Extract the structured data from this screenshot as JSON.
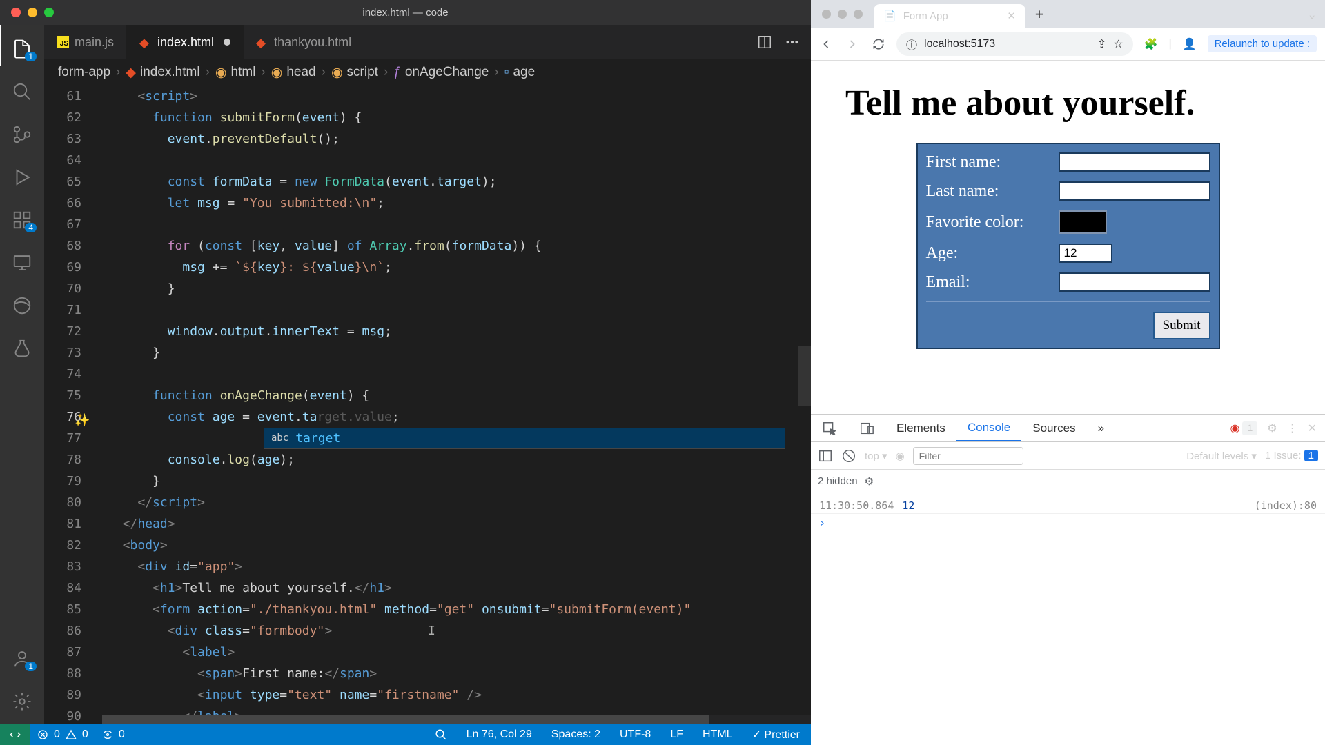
{
  "vscode": {
    "window_title": "index.html — code",
    "tabs": [
      {
        "label": "main.js",
        "icon": "js"
      },
      {
        "label": "index.html",
        "icon": "html",
        "active": true,
        "dirty": true
      },
      {
        "label": "thankyou.html",
        "icon": "html"
      }
    ],
    "breadcrumb": [
      "form-app",
      "index.html",
      "html",
      "head",
      "script",
      "onAgeChange",
      "age"
    ],
    "activity_badges": {
      "explorer": "1",
      "ext": "4",
      "account": "1"
    },
    "lines": [
      {
        "n": 61,
        "tokens": [
          [
            "k-white",
            "    "
          ],
          [
            "k-brack",
            "<"
          ],
          [
            "k-tag",
            "script"
          ],
          [
            "k-brack",
            ">"
          ]
        ]
      },
      {
        "n": 62,
        "tokens": [
          [
            "k-white",
            "      "
          ],
          [
            "k-blue",
            "function"
          ],
          [
            "k-white",
            " "
          ],
          [
            "k-yellow",
            "submitForm"
          ],
          [
            "k-white",
            "("
          ],
          [
            "k-var",
            "event"
          ],
          [
            "k-white",
            ") {"
          ]
        ]
      },
      {
        "n": 63,
        "tokens": [
          [
            "k-white",
            "        "
          ],
          [
            "k-var",
            "event"
          ],
          [
            "k-white",
            "."
          ],
          [
            "k-yellow",
            "preventDefault"
          ],
          [
            "k-white",
            "();"
          ]
        ]
      },
      {
        "n": 64,
        "tokens": []
      },
      {
        "n": 65,
        "tokens": [
          [
            "k-white",
            "        "
          ],
          [
            "k-blue",
            "const"
          ],
          [
            "k-white",
            " "
          ],
          [
            "k-var",
            "formData"
          ],
          [
            "k-white",
            " = "
          ],
          [
            "k-blue",
            "new"
          ],
          [
            "k-white",
            " "
          ],
          [
            "k-type",
            "FormData"
          ],
          [
            "k-white",
            "("
          ],
          [
            "k-var",
            "event"
          ],
          [
            "k-white",
            "."
          ],
          [
            "k-var",
            "target"
          ],
          [
            "k-white",
            ");"
          ]
        ]
      },
      {
        "n": 66,
        "tokens": [
          [
            "k-white",
            "        "
          ],
          [
            "k-blue",
            "let"
          ],
          [
            "k-white",
            " "
          ],
          [
            "k-var",
            "msg"
          ],
          [
            "k-white",
            " = "
          ],
          [
            "k-str",
            "\"You submitted:\\n\""
          ],
          [
            "k-white",
            ";"
          ]
        ]
      },
      {
        "n": 67,
        "tokens": []
      },
      {
        "n": 68,
        "tokens": [
          [
            "k-white",
            "        "
          ],
          [
            "k-purple",
            "for"
          ],
          [
            "k-white",
            " ("
          ],
          [
            "k-blue",
            "const"
          ],
          [
            "k-white",
            " ["
          ],
          [
            "k-var",
            "key"
          ],
          [
            "k-white",
            ", "
          ],
          [
            "k-var",
            "value"
          ],
          [
            "k-white",
            "] "
          ],
          [
            "k-blue",
            "of"
          ],
          [
            "k-white",
            " "
          ],
          [
            "k-type",
            "Array"
          ],
          [
            "k-white",
            "."
          ],
          [
            "k-yellow",
            "from"
          ],
          [
            "k-white",
            "("
          ],
          [
            "k-var",
            "formData"
          ],
          [
            "k-white",
            ")) {"
          ]
        ]
      },
      {
        "n": 69,
        "tokens": [
          [
            "k-white",
            "          "
          ],
          [
            "k-var",
            "msg"
          ],
          [
            "k-white",
            " += "
          ],
          [
            "k-str",
            "`${"
          ],
          [
            "k-var",
            "key"
          ],
          [
            "k-str",
            "}: ${"
          ],
          [
            "k-var",
            "value"
          ],
          [
            "k-str",
            "}\\n`"
          ],
          [
            "k-white",
            ";"
          ]
        ]
      },
      {
        "n": 70,
        "tokens": [
          [
            "k-white",
            "        }"
          ]
        ]
      },
      {
        "n": 71,
        "tokens": []
      },
      {
        "n": 72,
        "tokens": [
          [
            "k-white",
            "        "
          ],
          [
            "k-var",
            "window"
          ],
          [
            "k-white",
            "."
          ],
          [
            "k-var",
            "output"
          ],
          [
            "k-white",
            "."
          ],
          [
            "k-var",
            "innerText"
          ],
          [
            "k-white",
            " = "
          ],
          [
            "k-var",
            "msg"
          ],
          [
            "k-white",
            ";"
          ]
        ]
      },
      {
        "n": 73,
        "tokens": [
          [
            "k-white",
            "      }"
          ]
        ]
      },
      {
        "n": 74,
        "tokens": []
      },
      {
        "n": 75,
        "tokens": [
          [
            "k-white",
            "      "
          ],
          [
            "k-blue",
            "function"
          ],
          [
            "k-white",
            " "
          ],
          [
            "k-yellow",
            "onAgeChange"
          ],
          [
            "k-white",
            "("
          ],
          [
            "k-var",
            "event"
          ],
          [
            "k-white",
            ") {"
          ]
        ]
      },
      {
        "n": 76,
        "tokens": [
          [
            "k-white",
            "        "
          ],
          [
            "k-blue",
            "const"
          ],
          [
            "k-white",
            " "
          ],
          [
            "k-var",
            "age"
          ],
          [
            "k-white",
            " = "
          ],
          [
            "k-var",
            "event"
          ],
          [
            "k-white",
            "."
          ],
          [
            "k-var",
            "ta"
          ],
          [
            "k-ghost",
            "rget.value"
          ],
          [
            "k-white",
            ";"
          ]
        ],
        "cur": true,
        "spark": true
      },
      {
        "n": 77,
        "tokens": [],
        "suggest": true
      },
      {
        "n": 78,
        "tokens": [
          [
            "k-white",
            "        "
          ],
          [
            "k-var",
            "console"
          ],
          [
            "k-white",
            "."
          ],
          [
            "k-yellow",
            "log"
          ],
          [
            "k-white",
            "("
          ],
          [
            "k-var",
            "age"
          ],
          [
            "k-white",
            ");"
          ]
        ]
      },
      {
        "n": 79,
        "tokens": [
          [
            "k-white",
            "      }"
          ]
        ]
      },
      {
        "n": 80,
        "tokens": [
          [
            "k-white",
            "    "
          ],
          [
            "k-brack",
            "</"
          ],
          [
            "k-tag",
            "script"
          ],
          [
            "k-brack",
            ">"
          ]
        ]
      },
      {
        "n": 81,
        "tokens": [
          [
            "k-white",
            "  "
          ],
          [
            "k-brack",
            "</"
          ],
          [
            "k-tag",
            "head"
          ],
          [
            "k-brack",
            ">"
          ]
        ]
      },
      {
        "n": 82,
        "tokens": [
          [
            "k-white",
            "  "
          ],
          [
            "k-brack",
            "<"
          ],
          [
            "k-tag",
            "body"
          ],
          [
            "k-brack",
            ">"
          ]
        ]
      },
      {
        "n": 83,
        "tokens": [
          [
            "k-white",
            "    "
          ],
          [
            "k-brack",
            "<"
          ],
          [
            "k-tag",
            "div"
          ],
          [
            "k-white",
            " "
          ],
          [
            "k-attr",
            "id"
          ],
          [
            "k-white",
            "="
          ],
          [
            "k-str",
            "\"app\""
          ],
          [
            "k-brack",
            ">"
          ]
        ]
      },
      {
        "n": 84,
        "tokens": [
          [
            "k-white",
            "      "
          ],
          [
            "k-brack",
            "<"
          ],
          [
            "k-tag",
            "h1"
          ],
          [
            "k-brack",
            ">"
          ],
          [
            "k-white",
            "Tell me about yourself."
          ],
          [
            "k-brack",
            "</"
          ],
          [
            "k-tag",
            "h1"
          ],
          [
            "k-brack",
            ">"
          ]
        ]
      },
      {
        "n": 85,
        "tokens": [
          [
            "k-white",
            "      "
          ],
          [
            "k-brack",
            "<"
          ],
          [
            "k-tag",
            "form"
          ],
          [
            "k-white",
            " "
          ],
          [
            "k-attr",
            "action"
          ],
          [
            "k-white",
            "="
          ],
          [
            "k-str",
            "\"./thankyou.html\""
          ],
          [
            "k-white",
            " "
          ],
          [
            "k-attr",
            "method"
          ],
          [
            "k-white",
            "="
          ],
          [
            "k-str",
            "\"get\""
          ],
          [
            "k-white",
            " "
          ],
          [
            "k-attr",
            "onsubmit"
          ],
          [
            "k-white",
            "="
          ],
          [
            "k-str",
            "\"submitForm(event)\""
          ]
        ]
      },
      {
        "n": 86,
        "tokens": [
          [
            "k-white",
            "        "
          ],
          [
            "k-brack",
            "<"
          ],
          [
            "k-tag",
            "div"
          ],
          [
            "k-white",
            " "
          ],
          [
            "k-attr",
            "class"
          ],
          [
            "k-white",
            "="
          ],
          [
            "k-str",
            "\"formbody\""
          ],
          [
            "k-brack",
            ">"
          ]
        ],
        "caret": true
      },
      {
        "n": 87,
        "tokens": [
          [
            "k-white",
            "          "
          ],
          [
            "k-brack",
            "<"
          ],
          [
            "k-tag",
            "label"
          ],
          [
            "k-brack",
            ">"
          ]
        ]
      },
      {
        "n": 88,
        "tokens": [
          [
            "k-white",
            "            "
          ],
          [
            "k-brack",
            "<"
          ],
          [
            "k-tag",
            "span"
          ],
          [
            "k-brack",
            ">"
          ],
          [
            "k-white",
            "First name:"
          ],
          [
            "k-brack",
            "</"
          ],
          [
            "k-tag",
            "span"
          ],
          [
            "k-brack",
            ">"
          ]
        ]
      },
      {
        "n": 89,
        "tokens": [
          [
            "k-white",
            "            "
          ],
          [
            "k-brack",
            "<"
          ],
          [
            "k-tag",
            "input"
          ],
          [
            "k-white",
            " "
          ],
          [
            "k-attr",
            "type"
          ],
          [
            "k-white",
            "="
          ],
          [
            "k-str",
            "\"text\""
          ],
          [
            "k-white",
            " "
          ],
          [
            "k-attr",
            "name"
          ],
          [
            "k-white",
            "="
          ],
          [
            "k-str",
            "\"firstname\""
          ],
          [
            "k-white",
            " "
          ],
          [
            "k-brack",
            "/>"
          ]
        ]
      },
      {
        "n": 90,
        "tokens": [
          [
            "k-white",
            "          "
          ],
          [
            "k-brack",
            "</"
          ],
          [
            "k-tag",
            "label"
          ],
          [
            "k-brack",
            ">"
          ]
        ]
      }
    ],
    "suggest": {
      "kind": "abc",
      "label": "target"
    },
    "status": {
      "errors": "0",
      "warnings": "0",
      "ports": "0",
      "ln_col": "Ln 76, Col 29",
      "spaces": "Spaces: 2",
      "encoding": "UTF-8",
      "eol": "LF",
      "lang": "HTML",
      "formatter": "Prettier"
    }
  },
  "browser": {
    "tab_title": "Form App",
    "url": "localhost:5173",
    "relaunch": "Relaunch to update :",
    "page": {
      "heading": "Tell me about yourself.",
      "fields": {
        "firstname": "First name:",
        "lastname": "Last name:",
        "favcolor": "Favorite color:",
        "age_label": "Age:",
        "age_value": "12",
        "email": "Email:"
      },
      "submit": "Submit"
    },
    "devtools": {
      "tabs": [
        "Elements",
        "Console",
        "Sources"
      ],
      "active_tab": "Console",
      "errors_badge": "1",
      "context": "top",
      "filter_placeholder": "Filter",
      "levels": "Default levels",
      "issues": "1 Issue:",
      "issues_badge": "1",
      "hidden": "2 hidden",
      "log": {
        "time": "11:30:50.864",
        "value": "12",
        "src": "(index):80"
      }
    }
  }
}
